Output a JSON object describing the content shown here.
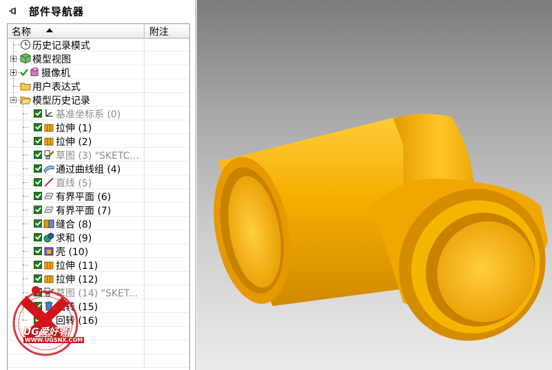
{
  "navigator": {
    "title": "部件导航器",
    "columns": {
      "name": "名称",
      "note": "附注"
    },
    "rows": [
      {
        "label": "历史记录模式",
        "icon": "clock-icon",
        "level": 1
      },
      {
        "label": "模型视图",
        "icon": "model-view-icon",
        "level": 1,
        "expander": "plus"
      },
      {
        "label": "摄像机",
        "icon": "camera-icon",
        "level": 1,
        "expander": "plus",
        "check": true
      },
      {
        "label": "用户表达式",
        "icon": "folder-icon",
        "level": 1
      },
      {
        "label": "模型历史记录",
        "icon": "folder-open-icon",
        "level": 1,
        "expander": "minus"
      },
      {
        "label": "基准坐标系 (0)",
        "icon": "datum-csys-icon",
        "level": 2,
        "check": true,
        "dim": true
      },
      {
        "label": "拉伸 (1)",
        "icon": "extrude-icon",
        "level": 2,
        "check": true
      },
      {
        "label": "拉伸 (2)",
        "icon": "extrude-icon",
        "level": 2,
        "check": true
      },
      {
        "label": "草图 (3) \"SKETC...",
        "icon": "sketch-icon",
        "level": 2,
        "check": true,
        "dim": true
      },
      {
        "label": "通过曲线组 (4)",
        "icon": "through-curves-icon",
        "level": 2,
        "check": true
      },
      {
        "label": "直线 (5)",
        "icon": "line-icon",
        "level": 2,
        "check": true,
        "dim": true
      },
      {
        "label": "有界平面 (6)",
        "icon": "bounded-plane-icon",
        "level": 2,
        "check": true
      },
      {
        "label": "有界平面 (7)",
        "icon": "bounded-plane-icon",
        "level": 2,
        "check": true
      },
      {
        "label": "缝合 (8)",
        "icon": "sew-icon",
        "level": 2,
        "check": true
      },
      {
        "label": "求和 (9)",
        "icon": "unite-icon",
        "level": 2,
        "check": true
      },
      {
        "label": "壳 (10)",
        "icon": "shell-icon",
        "level": 2,
        "check": true
      },
      {
        "label": "拉伸 (11)",
        "icon": "extrude-icon",
        "level": 2,
        "check": true
      },
      {
        "label": "拉伸 (12)",
        "icon": "extrude-icon",
        "level": 2,
        "check": true
      },
      {
        "label": "草图 (14) \"SKET...",
        "icon": "sketch-icon",
        "level": 2,
        "check": true,
        "dim": true
      },
      {
        "label": "回转 (15)",
        "icon": "revolve-icon",
        "level": 2,
        "check": true
      },
      {
        "label": "回转 (16)",
        "icon": "revolve-icon",
        "level": 2,
        "check": true
      }
    ]
  },
  "watermark": {
    "brand": "UG爱好者",
    "url": "WWW.UGSNX.COM"
  },
  "colors": {
    "part": "#f5b200",
    "part_shadow": "#c98400",
    "check": "#1f7a1f"
  }
}
